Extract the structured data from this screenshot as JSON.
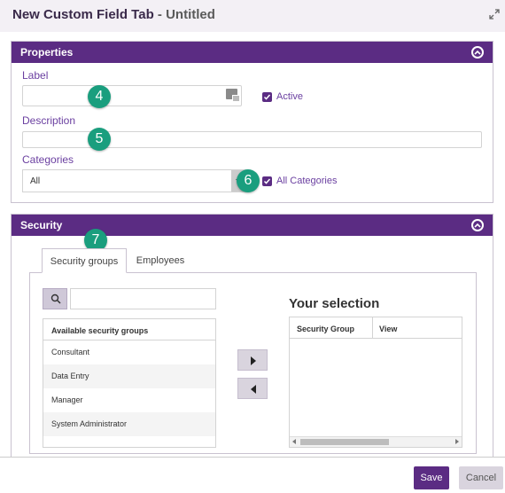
{
  "dialog": {
    "title": "New Custom Field Tab",
    "title_separator": " - ",
    "subtitle": "Untitled",
    "expand_icon": "expand-icon"
  },
  "properties": {
    "header": "Properties",
    "label_field": {
      "label": "Label",
      "value": "",
      "placeholder": ""
    },
    "active": {
      "label": "Active",
      "checked": true
    },
    "description_field": {
      "label": "Description",
      "value": ""
    },
    "categories_field": {
      "label": "Categories",
      "selected": "All"
    },
    "all_categories": {
      "label": "All Categories",
      "checked": true
    }
  },
  "callouts": {
    "c4": "4",
    "c5": "5",
    "c6": "6",
    "c7": "7"
  },
  "security": {
    "header": "Security",
    "tabs": [
      {
        "label": "Security groups",
        "active": true
      },
      {
        "label": "Employees",
        "active": false
      }
    ],
    "search": {
      "value": "",
      "placeholder": ""
    },
    "available": {
      "header": "Available security groups",
      "items": [
        "Consultant",
        "Data Entry",
        "Manager",
        "System Administrator"
      ]
    },
    "selection": {
      "title": "Your selection",
      "columns": [
        "Security Group",
        "View"
      ]
    }
  },
  "footer": {
    "save_label": "Save",
    "cancel_label": "Cancel"
  },
  "colors": {
    "accent": "#5b2c83",
    "callout": "#1a9e7e"
  }
}
